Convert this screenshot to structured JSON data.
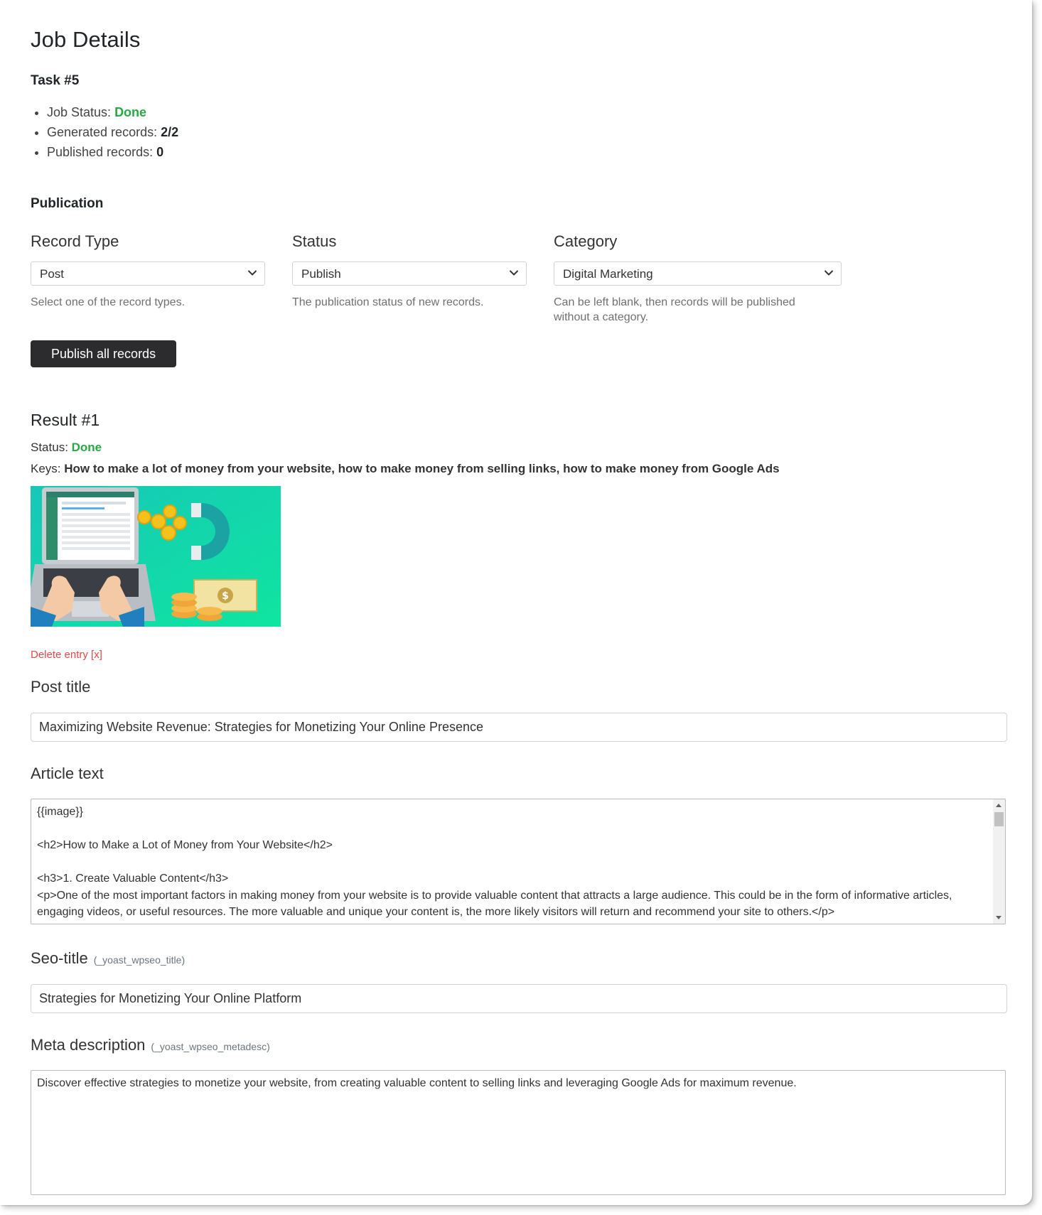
{
  "page": {
    "title": "Job Details"
  },
  "task": {
    "heading": "Task #5",
    "job_status_label": "Job Status: ",
    "job_status_value": "Done",
    "generated_label": "Generated records: ",
    "generated_value": "2/2",
    "published_label": "Published records: ",
    "published_value": "0"
  },
  "publication": {
    "heading": "Publication",
    "record_type": {
      "label": "Record Type",
      "value": "Post",
      "help": "Select one of the record types."
    },
    "status": {
      "label": "Status",
      "value": "Publish",
      "help": "The publication status of new records."
    },
    "category": {
      "label": "Category",
      "value": "Digital Marketing",
      "help": "Can be left blank, then records will be published without a category."
    },
    "publish_button": "Publish all records"
  },
  "result": {
    "heading": "Result #1",
    "status_label": "Status: ",
    "status_value": "Done",
    "keys_label": "Keys: ",
    "keys_value": "How to make a lot of money from your website, how to make money from selling links, how to make money from Google Ads",
    "delete_link": "Delete entry [x]",
    "post_title": {
      "label": "Post title",
      "value": "Maximizing Website Revenue: Strategies for Monetizing Your Online Presence"
    },
    "article_text": {
      "label": "Article text",
      "value": "{{image}}\n\n<h2>How to Make a Lot of Money from Your Website</h2>\n\n<h3>1. Create Valuable Content</h3>\n<p>One of the most important factors in making money from your website is to provide valuable content that attracts a large audience. This could be in the form of informative articles, engaging videos, or useful resources. The more valuable and unique your content is, the more likely visitors will return and recommend your site to others.</p>"
    },
    "seo_title": {
      "label": "Seo-title",
      "meta_key": "(_yoast_wpseo_title)",
      "value": "Strategies for Monetizing Your Online Platform"
    },
    "meta_description": {
      "label": "Meta description",
      "meta_key": "(_yoast_wpseo_metadesc)",
      "value": "Discover effective strategies to monetize your website, from creating valuable content to selling links and leveraging Google Ads for maximum revenue."
    }
  },
  "icons": {
    "select_arrow": "chevron-down-icon",
    "scroll_up": "scroll-up-arrow-icon",
    "scroll_down": "scroll-down-arrow-icon"
  },
  "colors": {
    "done_green": "#28a745",
    "delete_red": "#e04848",
    "button_dark": "#2c2c2e"
  }
}
